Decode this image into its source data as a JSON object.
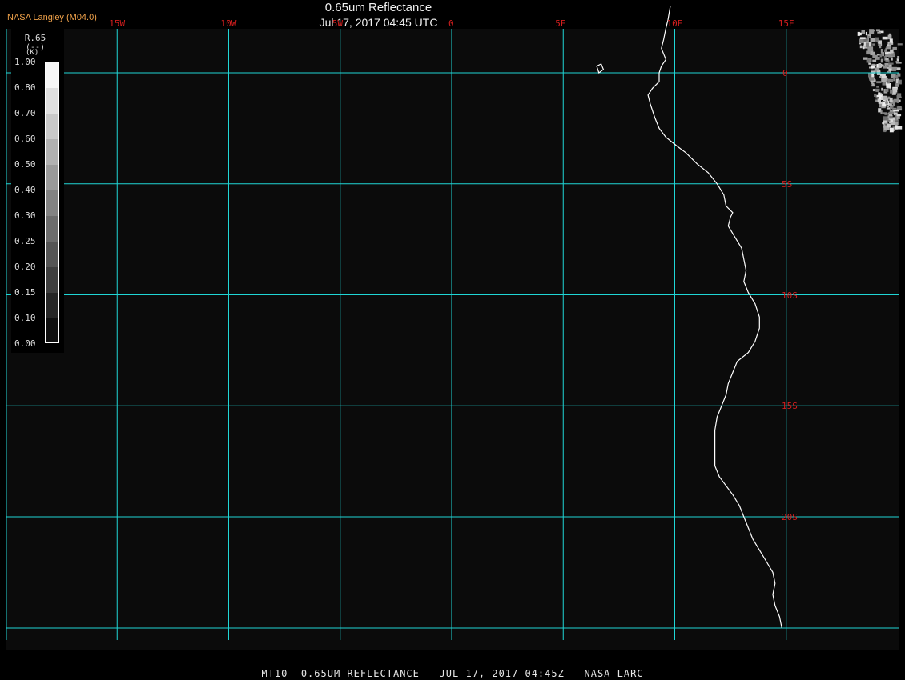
{
  "header": {
    "title": "0.65um Reflectance",
    "subtitle": "Jul 17, 2017 04:45 UTC",
    "brand": "NASA Langley (M04.0)"
  },
  "footer": {
    "text": "MT10  0.65UM REFLECTANCE   JUL 17, 2017 04:45Z   NASA LARC"
  },
  "map": {
    "lon_range": [
      -20,
      15
    ],
    "lat_range": [
      -25,
      2
    ],
    "lon_grid": [
      {
        "value": -15,
        "label": "15W"
      },
      {
        "value": -10,
        "label": "10W"
      },
      {
        "value": -5,
        "label": "5W"
      },
      {
        "value": 0,
        "label": "0"
      },
      {
        "value": 5,
        "label": "5E"
      },
      {
        "value": 10,
        "label": "10E"
      },
      {
        "value": 15,
        "label": "15E"
      }
    ],
    "lat_grid": [
      {
        "value": 0,
        "label": "0"
      },
      {
        "value": -5,
        "label": "5S"
      },
      {
        "value": -10,
        "label": "10S"
      },
      {
        "value": -15,
        "label": "15S"
      },
      {
        "value": -20,
        "label": "20S"
      }
    ],
    "colors": {
      "background": "#0b0b0b",
      "grid": "#1fd6d6",
      "grid_labels": "#d21e1e",
      "coastline": "#ffffff"
    },
    "coastline": [
      [
        9.8,
        3.0
      ],
      [
        9.7,
        2.4
      ],
      [
        9.6,
        2.0
      ],
      [
        9.5,
        1.5
      ],
      [
        9.4,
        1.1
      ],
      [
        9.6,
        0.6
      ],
      [
        9.4,
        0.3
      ],
      [
        9.3,
        0.0
      ],
      [
        9.3,
        -0.4
      ],
      [
        9.0,
        -0.7
      ],
      [
        8.8,
        -1.0
      ],
      [
        8.9,
        -1.4
      ],
      [
        9.1,
        -2.0
      ],
      [
        9.3,
        -2.5
      ],
      [
        9.6,
        -2.9
      ],
      [
        10.1,
        -3.3
      ],
      [
        10.5,
        -3.6
      ],
      [
        11.0,
        -4.1
      ],
      [
        11.5,
        -4.5
      ],
      [
        11.9,
        -5.0
      ],
      [
        12.2,
        -5.5
      ],
      [
        12.3,
        -6.0
      ],
      [
        12.6,
        -6.3
      ],
      [
        12.5,
        -6.5
      ],
      [
        12.4,
        -6.9
      ],
      [
        12.7,
        -7.4
      ],
      [
        13.0,
        -7.9
      ],
      [
        13.1,
        -8.4
      ],
      [
        13.2,
        -8.9
      ],
      [
        13.1,
        -9.4
      ],
      [
        13.3,
        -9.9
      ],
      [
        13.6,
        -10.4
      ],
      [
        13.8,
        -11.0
      ],
      [
        13.8,
        -11.5
      ],
      [
        13.6,
        -12.1
      ],
      [
        13.3,
        -12.6
      ],
      [
        12.8,
        -13.0
      ],
      [
        12.6,
        -13.5
      ],
      [
        12.4,
        -14.0
      ],
      [
        12.3,
        -14.5
      ],
      [
        12.1,
        -15.0
      ],
      [
        11.9,
        -15.5
      ],
      [
        11.8,
        -16.1
      ],
      [
        11.8,
        -16.6
      ],
      [
        11.8,
        -17.2
      ],
      [
        11.8,
        -17.7
      ],
      [
        12.0,
        -18.2
      ],
      [
        12.3,
        -18.6
      ],
      [
        12.6,
        -19.0
      ],
      [
        12.9,
        -19.5
      ],
      [
        13.1,
        -20.0
      ],
      [
        13.3,
        -20.5
      ],
      [
        13.5,
        -21.0
      ],
      [
        13.8,
        -21.5
      ],
      [
        14.1,
        -22.0
      ],
      [
        14.4,
        -22.5
      ],
      [
        14.5,
        -23.0
      ],
      [
        14.4,
        -23.5
      ],
      [
        14.5,
        -24.0
      ],
      [
        14.7,
        -24.5
      ],
      [
        14.8,
        -25.0
      ]
    ],
    "island": [
      [
        6.5,
        0.3
      ],
      [
        6.7,
        0.4
      ],
      [
        6.8,
        0.15
      ],
      [
        6.6,
        0.0
      ],
      [
        6.5,
        0.3
      ]
    ]
  },
  "legend": {
    "title": "R.65",
    "unit": "(--)",
    "k_label": "(K)",
    "ticks": [
      "1.00",
      "0.80",
      "0.70",
      "0.60",
      "0.50",
      "0.40",
      "0.30",
      "0.25",
      "0.20",
      "0.15",
      "0.10",
      "0.00"
    ],
    "tick_values": [
      1.0,
      0.8,
      0.7,
      0.6,
      0.5,
      0.4,
      0.3,
      0.25,
      0.2,
      0.15,
      0.1,
      0.0
    ]
  }
}
